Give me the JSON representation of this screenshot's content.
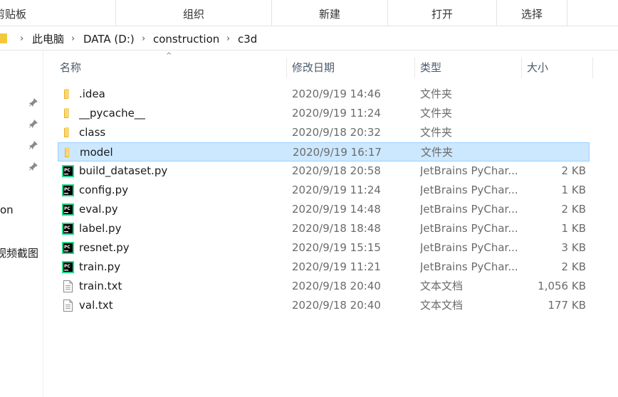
{
  "ribbon": {
    "clipboard_label": "剪贴板",
    "organize_label": "组织",
    "new_label": "新建",
    "open_label": "打开",
    "select_label": "选择"
  },
  "address": {
    "crumbs": [
      "此电脑",
      "DATA (D:)",
      "construction",
      "c3d"
    ]
  },
  "nav": {
    "item_on": "on",
    "item_screenshots": "视频截图"
  },
  "columns": {
    "name": "名称",
    "date": "修改日期",
    "type": "类型",
    "size": "大小"
  },
  "files": [
    {
      "name": ".idea",
      "date": "2020/9/19 14:46",
      "type": "文件夹",
      "size": "",
      "icon": "folder-icon"
    },
    {
      "name": "__pycache__",
      "date": "2020/9/19 11:24",
      "type": "文件夹",
      "size": "",
      "icon": "folder-icon"
    },
    {
      "name": "class",
      "date": "2020/9/18 20:32",
      "type": "文件夹",
      "size": "",
      "icon": "folder-icon"
    },
    {
      "name": "model",
      "date": "2020/9/19 16:17",
      "type": "文件夹",
      "size": "",
      "icon": "folder-icon",
      "selected": true
    },
    {
      "name": "build_dataset.py",
      "date": "2020/9/18 20:58",
      "type": "JetBrains PyChar...",
      "size": "2 KB",
      "icon": "pycharm-file-icon"
    },
    {
      "name": "config.py",
      "date": "2020/9/19 11:24",
      "type": "JetBrains PyChar...",
      "size": "1 KB",
      "icon": "pycharm-file-icon"
    },
    {
      "name": "eval.py",
      "date": "2020/9/19 14:48",
      "type": "JetBrains PyChar...",
      "size": "2 KB",
      "icon": "pycharm-file-icon"
    },
    {
      "name": "label.py",
      "date": "2020/9/18 18:48",
      "type": "JetBrains PyChar...",
      "size": "1 KB",
      "icon": "pycharm-file-icon"
    },
    {
      "name": "resnet.py",
      "date": "2020/9/19 15:15",
      "type": "JetBrains PyChar...",
      "size": "3 KB",
      "icon": "pycharm-file-icon"
    },
    {
      "name": "train.py",
      "date": "2020/9/19 11:21",
      "type": "JetBrains PyChar...",
      "size": "2 KB",
      "icon": "pycharm-file-icon"
    },
    {
      "name": "train.txt",
      "date": "2020/9/18 20:40",
      "type": "文本文档",
      "size": "1,056 KB",
      "icon": "text-file-icon"
    },
    {
      "name": "val.txt",
      "date": "2020/9/18 20:40",
      "type": "文本文档",
      "size": "177 KB",
      "icon": "text-file-icon"
    }
  ],
  "colors": {
    "folder": "#f3c93a",
    "selection_bg": "#cce8ff",
    "selection_border": "#99d1ff",
    "pycharm_bg": "#1a1a1a",
    "pycharm_accent": "#21d789"
  }
}
